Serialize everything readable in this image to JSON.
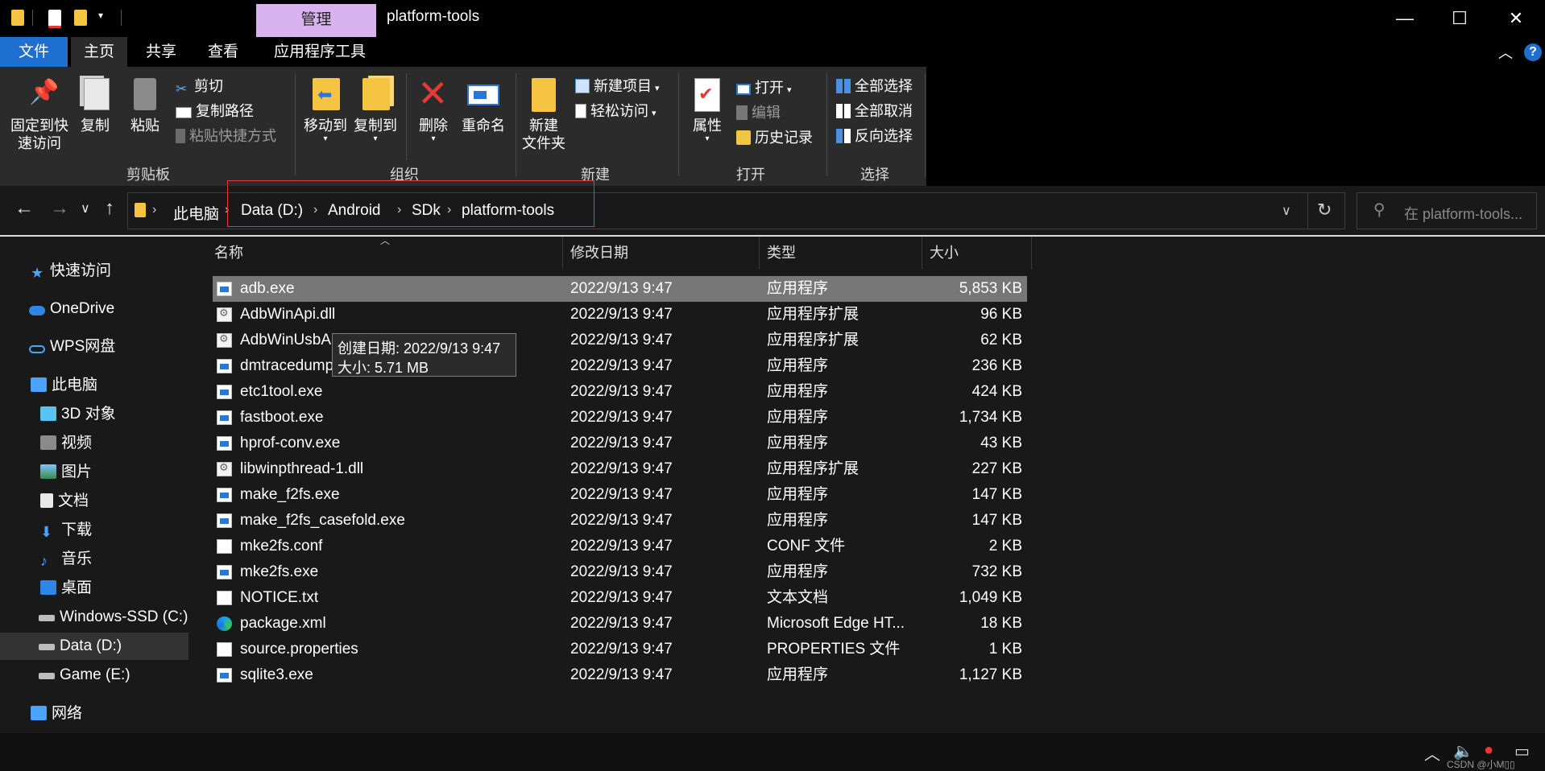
{
  "window": {
    "title": "platform-tools",
    "context_tab": "管理",
    "minimize": "—",
    "maximize": "☐",
    "close": "✕"
  },
  "ribbon_tabs": {
    "file": "文件",
    "home": "主页",
    "share": "共享",
    "view": "查看",
    "app_tools": "应用程序工具"
  },
  "ribbon": {
    "clipboard": {
      "pin_line1": "固定到快",
      "pin_line2": "速访问",
      "copy": "复制",
      "paste": "粘贴",
      "cut": "剪切",
      "copy_path": "复制路径",
      "paste_shortcut": "粘贴快捷方式",
      "group": "剪贴板"
    },
    "organize": {
      "move_to": "移动到",
      "copy_to": "复制到",
      "delete": "删除",
      "rename": "重命名",
      "group": "组织"
    },
    "new": {
      "new_folder_line1": "新建",
      "new_folder_line2": "文件夹",
      "new_item": "新建项目",
      "easy_access": "轻松访问",
      "group": "新建"
    },
    "open": {
      "properties": "属性",
      "open": "打开",
      "edit": "编辑",
      "history": "历史记录",
      "group": "打开"
    },
    "select": {
      "select_all": "全部选择",
      "select_none": "全部取消",
      "invert": "反向选择",
      "group": "选择"
    }
  },
  "address": {
    "crumbs": [
      "此电脑",
      "Data (D:)",
      "Android",
      "SDk",
      "platform-tools"
    ],
    "search_placeholder": "在 platform-tools..."
  },
  "nav": {
    "quick_access": "快速访问",
    "onedrive": "OneDrive",
    "wps": "WPS网盘",
    "this_pc": "此电脑",
    "objects3d": "3D 对象",
    "videos": "视频",
    "pictures": "图片",
    "documents": "文档",
    "downloads": "下载",
    "music": "音乐",
    "desktop": "桌面",
    "drive_c": "Windows-SSD (C:)",
    "drive_d": "Data (D:)",
    "drive_e": "Game (E:)",
    "network": "网络"
  },
  "columns": {
    "name": "名称",
    "modified": "修改日期",
    "type": "类型",
    "size": "大小"
  },
  "files": [
    {
      "name": "adb.exe",
      "date": "2022/9/13 9:47",
      "type": "应用程序",
      "size": "5,853 KB",
      "icon": "exe-icon"
    },
    {
      "name": "AdbWinApi.dll",
      "date": "2022/9/13 9:47",
      "type": "应用程序扩展",
      "size": "96 KB",
      "icon": "dll-icon"
    },
    {
      "name": "AdbWinUsbA",
      "date": "2022/9/13 9:47",
      "type": "应用程序扩展",
      "size": "62 KB",
      "icon": "dll-icon"
    },
    {
      "name": "dmtracedump",
      "date": "2022/9/13 9:47",
      "type": "应用程序",
      "size": "236 KB",
      "icon": "exe-icon"
    },
    {
      "name": "etc1tool.exe",
      "date": "2022/9/13 9:47",
      "type": "应用程序",
      "size": "424 KB",
      "icon": "exe-icon"
    },
    {
      "name": "fastboot.exe",
      "date": "2022/9/13 9:47",
      "type": "应用程序",
      "size": "1,734 KB",
      "icon": "exe-icon"
    },
    {
      "name": "hprof-conv.exe",
      "date": "2022/9/13 9:47",
      "type": "应用程序",
      "size": "43 KB",
      "icon": "exe-icon"
    },
    {
      "name": "libwinpthread-1.dll",
      "date": "2022/9/13 9:47",
      "type": "应用程序扩展",
      "size": "227 KB",
      "icon": "dll-icon"
    },
    {
      "name": "make_f2fs.exe",
      "date": "2022/9/13 9:47",
      "type": "应用程序",
      "size": "147 KB",
      "icon": "exe-icon"
    },
    {
      "name": "make_f2fs_casefold.exe",
      "date": "2022/9/13 9:47",
      "type": "应用程序",
      "size": "147 KB",
      "icon": "exe-icon"
    },
    {
      "name": "mke2fs.conf",
      "date": "2022/9/13 9:47",
      "type": "CONF 文件",
      "size": "2 KB",
      "icon": "doc-icon"
    },
    {
      "name": "mke2fs.exe",
      "date": "2022/9/13 9:47",
      "type": "应用程序",
      "size": "732 KB",
      "icon": "exe-icon"
    },
    {
      "name": "NOTICE.txt",
      "date": "2022/9/13 9:47",
      "type": "文本文档",
      "size": "1,049 KB",
      "icon": "doc-icon"
    },
    {
      "name": "package.xml",
      "date": "2022/9/13 9:47",
      "type": "Microsoft Edge HT...",
      "size": "18 KB",
      "icon": "edge-icon"
    },
    {
      "name": "source.properties",
      "date": "2022/9/13 9:47",
      "type": "PROPERTIES 文件",
      "size": "1 KB",
      "icon": "doc-icon"
    },
    {
      "name": "sqlite3.exe",
      "date": "2022/9/13 9:47",
      "type": "应用程序",
      "size": "1,127 KB",
      "icon": "exe-icon"
    }
  ],
  "tooltip": {
    "created": "创建日期: 2022/9/13 9:47",
    "size": "大小: 5.71 MB"
  },
  "watermark": "CSDN @小M▯▯"
}
